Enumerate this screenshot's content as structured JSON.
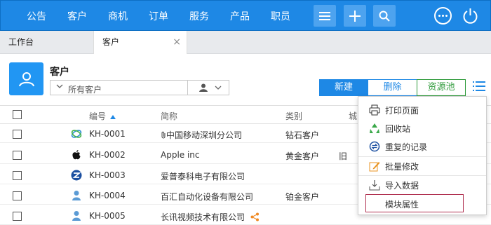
{
  "nav": {
    "items": [
      "公告",
      "客户",
      "商机",
      "订单",
      "服务",
      "产品",
      "职员"
    ],
    "menu_icon": "hamburger-icon",
    "add_icon": "plus-icon",
    "search_icon": "search-icon",
    "more_icon": "more-dots-icon",
    "power_icon": "power-icon"
  },
  "tabs": {
    "workbench": "工作台",
    "customer": "客户",
    "close": "×"
  },
  "header": {
    "title": "客户",
    "filter_value": "所有客户",
    "new_label": "新建",
    "delete_label": "删除",
    "pool_label": "资源池"
  },
  "table": {
    "columns": {
      "code": "编号",
      "name": "简称",
      "category": "类别",
      "city": "城"
    },
    "rows": [
      {
        "icon": "china-mobile-icon",
        "code": "KH-0001",
        "name": "中国移动深圳分公司",
        "category": "钻石客户",
        "city": "",
        "attach": true
      },
      {
        "icon": "apple-logo-icon",
        "code": "KH-0002",
        "name": "Apple inc",
        "category": "黄金客户",
        "city": "旧"
      },
      {
        "icon": "brand-z-icon",
        "code": "KH-0003",
        "name": "爱普泰科电子有限公司",
        "category": "",
        "city": ""
      },
      {
        "icon": "person-icon",
        "code": "KH-0004",
        "name": "百汇自动化设备有限公司",
        "category": "铂金客户",
        "city": ""
      },
      {
        "icon": "person-icon",
        "code": "KH-0005",
        "name": "长讯视频技术有限公司",
        "category": "",
        "city": "",
        "share": true
      }
    ]
  },
  "menu": {
    "items": [
      {
        "label": "打印页面",
        "icon": "printer-icon"
      },
      {
        "label": "回收站",
        "icon": "recycle-icon"
      },
      {
        "label": "重复的记录",
        "icon": "duplicate-icon"
      },
      {
        "label": "批量修改",
        "icon": "edit-icon"
      },
      {
        "label": "导入数据",
        "icon": "import-icon"
      },
      {
        "label": "模块属性",
        "icon": ""
      }
    ]
  },
  "colors": {
    "primary": "#1e88e5",
    "green": "#2e9a3a",
    "highlight_border": "#b03050"
  }
}
